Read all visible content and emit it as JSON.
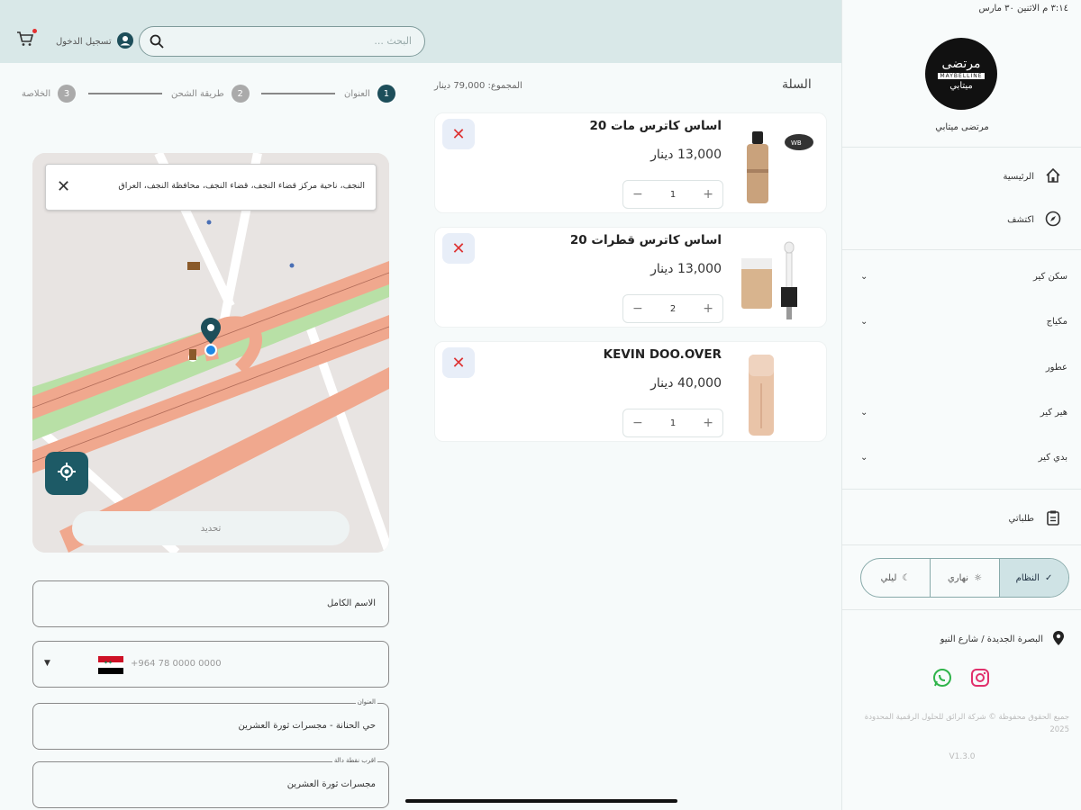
{
  "status": {
    "time": "٣:١٤ م   الاثنين ٣٠ مارس",
    "dots": "•••"
  },
  "header": {
    "search_placeholder": "البحث ...",
    "login_label": "تسجيل الدخول"
  },
  "sidebar": {
    "store_name": "مرتضى ميتابي",
    "nav": [
      {
        "label": "الرئيسية",
        "icon": "home-icon"
      },
      {
        "label": "اكتشف",
        "icon": "compass-icon"
      }
    ],
    "categories": [
      {
        "label": "سكن كير",
        "expandable": true
      },
      {
        "label": "مكياج",
        "expandable": true
      },
      {
        "label": "عطور",
        "expandable": false
      },
      {
        "label": "هير كير",
        "expandable": true
      },
      {
        "label": "بدي كير",
        "expandable": true
      }
    ],
    "orders_label": "طلباتي",
    "theme": {
      "system": "النظام",
      "light": "نهاري",
      "dark": "ليلي",
      "selected": "system"
    },
    "address": "البصرة الجديدة / شارع النيو",
    "copyright": "جميع الحقوق محفوظة © شركة الرائق للحلول الرقمية المحدودة 2025",
    "version": "V1.3.0"
  },
  "cart": {
    "title": "السلة",
    "total": "المجموع: 79,000 دينار",
    "items": [
      {
        "name": "اساس كاترس مات 20",
        "price": "13,000 دينار",
        "qty": "1"
      },
      {
        "name": "اساس كاترس قطرات 20",
        "price": "13,000 دينار",
        "qty": "2"
      },
      {
        "name": "KEVIN DOO.OVER",
        "price": "40,000 دينار",
        "qty": "1"
      }
    ]
  },
  "steps": [
    {
      "num": "1",
      "label": "العنوان",
      "active": true
    },
    {
      "num": "2",
      "label": "طريقة الشحن",
      "active": false
    },
    {
      "num": "3",
      "label": "الخلاصة",
      "active": false
    }
  ],
  "map": {
    "banner": "النجف، ناحية مركز قضاء النجف، قضاء النجف، محافظة النجف، العراق",
    "confirm_label": "تحديد"
  },
  "form": {
    "full_name": "الاسم الكامل",
    "phone_placeholder": "+964 78 0000 0000",
    "address_label": "العنوان",
    "address_value": "حي الحنانة - مجسرات ثورة العشرين",
    "landmark_label": "اقرب نقطة دالة",
    "landmark_value": "مجسرات ثورة العشرين"
  },
  "colors": {
    "primary": "#1d4e5a",
    "topbar": "#d9e8e8",
    "remove": "#d33333"
  }
}
